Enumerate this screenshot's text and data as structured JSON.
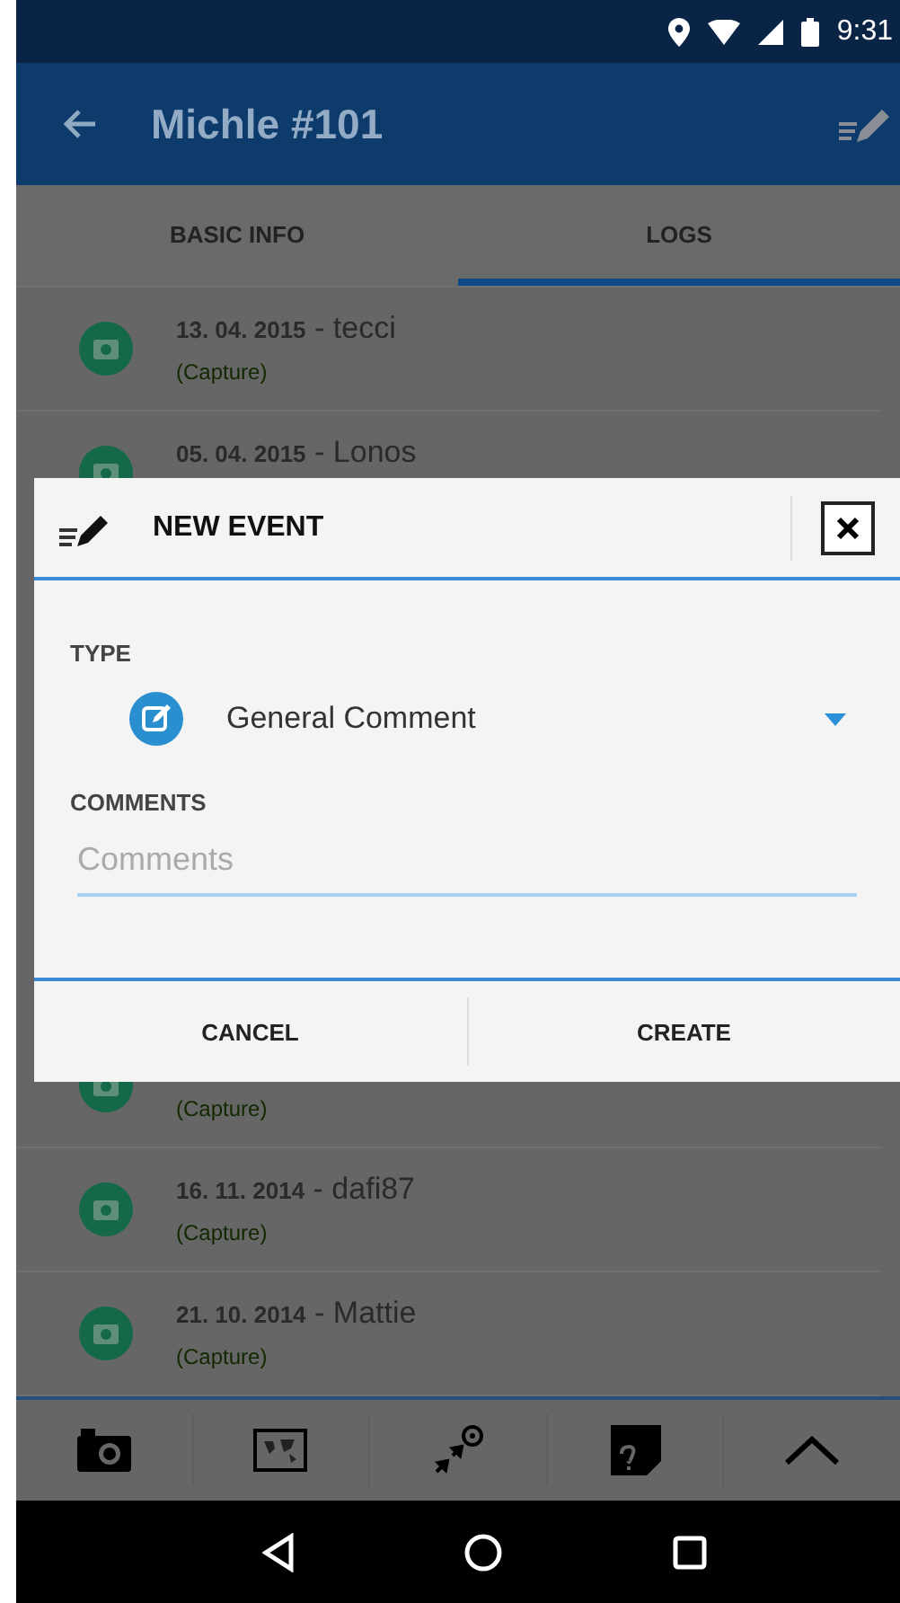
{
  "status_bar": {
    "time": "9:31"
  },
  "app_bar": {
    "title": "Michle #101"
  },
  "tabs": [
    {
      "label": "BASIC INFO",
      "selected": false
    },
    {
      "label": "LOGS",
      "selected": true
    }
  ],
  "logs_above": [
    {
      "title": "**13. 04. 2015** - tecci",
      "type": "(Capture)"
    },
    {
      "title": "**05. 04. 2015** - Lonos"
    }
  ],
  "dialog": {
    "title": "NEW EVENT",
    "type_label": "TYPE",
    "type_value": "General Comment",
    "comments_label": "COMMENTS",
    "comments": {
      "placeholder": "Comments"
    },
    "buttons": [
      "CANCEL",
      "CREATE"
    ]
  },
  "logs_below": [
    {
      "type": "(Capture)"
    },
    {
      "title": "**16. 11. 2014** - dafi87",
      "type": "(Capture)"
    },
    {
      "title": "**21. 10. 2014** - Mattie",
      "type": "(Capture)"
    }
  ]
}
